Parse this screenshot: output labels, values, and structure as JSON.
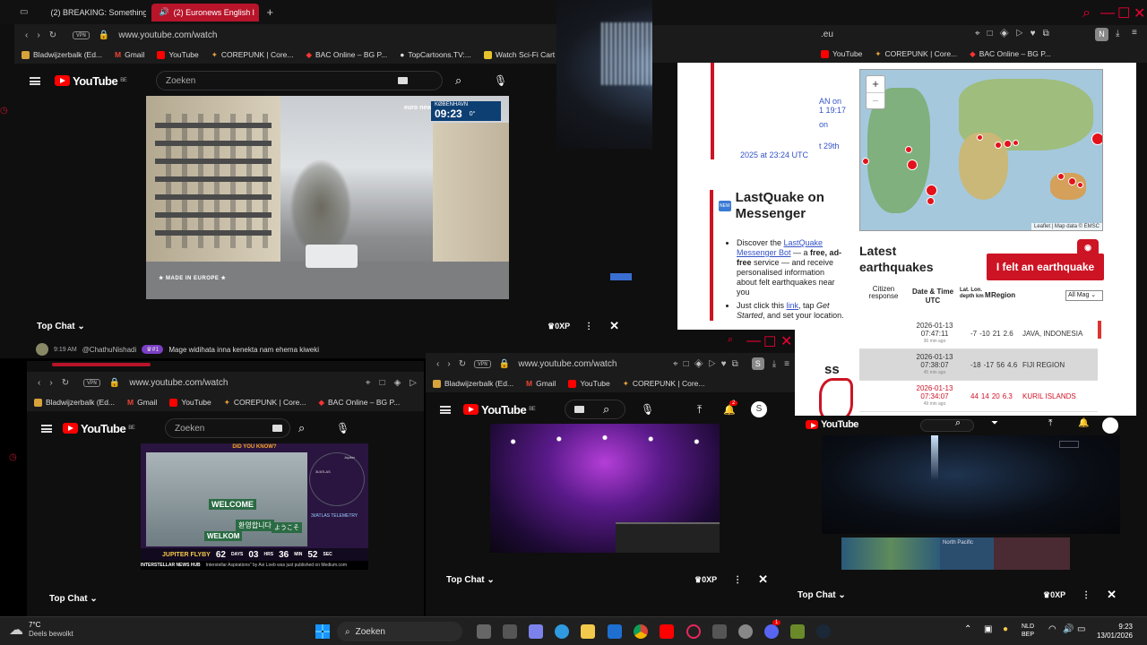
{
  "colors": {
    "accent": "#b8142a",
    "youtube_red": "#ff0000",
    "quake_red": "#cc1424",
    "link": "#3553c7"
  },
  "win1": {
    "tabs": [
      "(2) BREAKING: Something",
      "(2) Euronews English l"
    ],
    "url": "www.youtube.com/watch",
    "vpn": "VPN",
    "bookmarks": [
      "Bladwijzerbalk (Ed...",
      "Gmail",
      "YouTube",
      "COREPUNK | Core...",
      "BAC Online – BG P...",
      "TopCartoons.TV:...",
      "Watch Sci-Fi Cart"
    ],
    "yt_logo": "YouTube",
    "yt_region": "BE",
    "search_placeholder": "Zoeken",
    "video": {
      "channel": "euro news.",
      "city": "KØBENHAVN",
      "time": "09:23",
      "temp": "0°",
      "badge": "MADE IN EUROPE"
    },
    "chat": {
      "title": "Top Chat",
      "xp": "0XP",
      "msg_time": "9:19 AM",
      "msg_user": "@ChathuNishadi",
      "msg_badge": "#1",
      "msg_text": "Mage widihata inna kenekta nam ehema kiweki"
    }
  },
  "win2": {
    "url": "www.youtube.com/watch",
    "vpn": "VPN",
    "bookmarks": [
      "Bladwijzerbalk (Ed...",
      "Gmail",
      "YouTube",
      "COREPUNK | Core...",
      "BAC Online – BG P..."
    ],
    "yt_logo": "YouTube",
    "yt_region": "BE",
    "search_placeholder": "Zoeken",
    "video": {
      "header": "DID YOU KNOW?",
      "welcome": "WELCOME",
      "welkom": "WELKOM",
      "korean": "환영합니다",
      "japanese": "ようこそ",
      "flyby": "JUPITER FLYBY",
      "days": "62",
      "days_l": "DAYS",
      "hrs": "03",
      "hrs_l": "HRS",
      "mins": "36",
      "mins_l": "MIN",
      "secs": "52",
      "secs_l": "SEC",
      "brand": "INTERSTELLAR NEWS HUB",
      "ticker": "Interstellar Aspirations\" by Avi Loeb was just published on Medium.com",
      "telemetry": "3I/ATLAS TELEMETRY",
      "jupiter": "Jupiter",
      "atlas": "3I/ATLAS"
    },
    "chat": {
      "title": "Top Chat"
    }
  },
  "win3": {
    "url": "www.youtube.com/watch",
    "vpn": "VPN",
    "bookmarks": [
      "Bladwijzerbalk (Ed...",
      "Gmail",
      "YouTube",
      "COREPUNK | Core..."
    ],
    "yt_logo": "YouTube",
    "yt_region": "BE",
    "notif": "2",
    "avatar": "S",
    "chat": {
      "title": "Top Chat",
      "xp": "0XP"
    }
  },
  "win4": {
    "url_tail": ".eu",
    "bookmarks": [
      "YouTube",
      "COREPUNK | Core...",
      "BAC Online – BG P..."
    ],
    "avatar": "N",
    "side_links": [
      "AN on",
      "1 19:17",
      "on",
      "t 29th",
      "2025 at 23:24 UTC"
    ],
    "messenger": {
      "icon": "NEW",
      "heading": "LastQuake on Messenger",
      "b1_pre": "Discover the ",
      "b1_link": "LastQuake Messenger Bot",
      "b1_mid": " — a ",
      "b1_bold": "free, ad-free",
      "b1_post": " service — and receive personalised information about felt earthquakes near you",
      "b2_pre": "Just click this ",
      "b2_link": "link",
      "b2_mid": ", tap ",
      "b2_italic": "Get Started",
      "b2_post": ", and set your location."
    },
    "frag": "ss",
    "map_attr": "Leaflet | Map data © EMSC",
    "zoom_in": "+",
    "zoom_out": "−",
    "latest": "Latest earthquakes",
    "felt_button": "I felt an earthquake",
    "cols": [
      "Citizen response",
      "Date & Time UTC",
      "Lat. Lon. depth km",
      "M",
      "Region"
    ],
    "mag_filter": "All Mag",
    "rows": [
      {
        "date": "2026-01-13",
        "time": "07:47:11",
        "ago": "36 min ago",
        "lat": "-7",
        "lon": "-10",
        "depth": "21",
        "mag": "2.6",
        "region": "JAVA, INDONESIA"
      },
      {
        "date": "2026-01-13",
        "time": "07:38:07",
        "ago": "45 min ago",
        "lat": "-18",
        "lon": "-17",
        "depth": "56",
        "mag": "4.6",
        "region": "FIJI REGION"
      },
      {
        "date": "2026-01-13",
        "time": "07:34:07",
        "ago": "49 min ago",
        "lat": "44",
        "lon": "14",
        "depth": "20",
        "mag": "6.3",
        "region": "KURIL ISLANDS"
      },
      {
        "date": "2026-01-13",
        "time": "",
        "ago": "",
        "lat": "",
        "lon": "",
        "depth": "",
        "mag": "",
        "region": ""
      }
    ]
  },
  "win5": {
    "yt_logo": "YouTube",
    "chat": {
      "title": "Top Chat",
      "xp": "0XP"
    },
    "thumb_label": "North Pacific"
  },
  "taskbar": {
    "weather_temp": "7°C",
    "weather_desc": "Deels bewolkt",
    "search": "Zoeken",
    "lang": "NLD",
    "lang2": "BEP",
    "time": "9:23",
    "date": "13/01/2026",
    "discord_badge": "1"
  }
}
